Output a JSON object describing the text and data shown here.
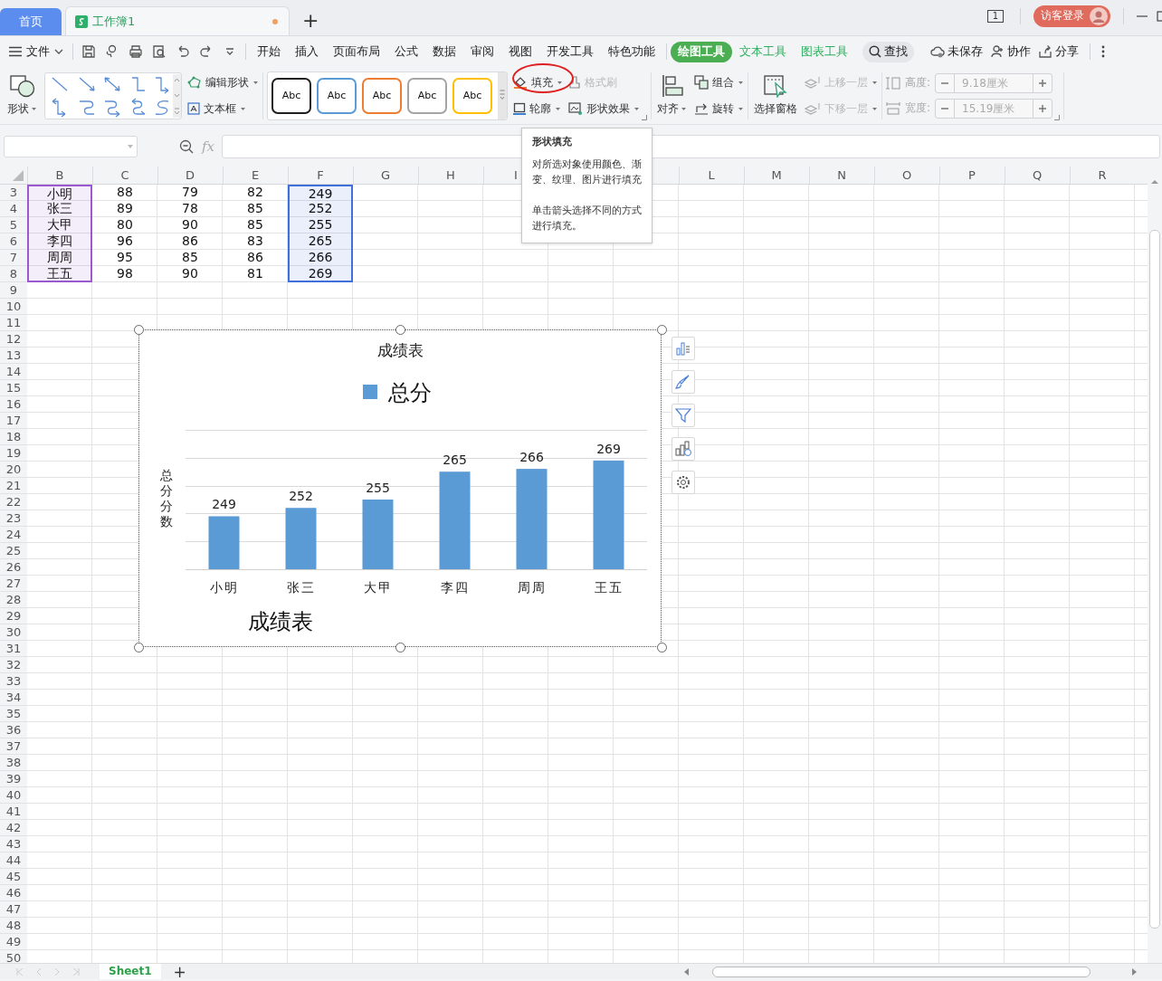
{
  "tabs": [
    {
      "label": "首页",
      "kind": "home",
      "selected": false
    },
    {
      "label": "工作簿1",
      "kind": "doc",
      "selected": true,
      "modified": true
    }
  ],
  "new_tab_button": "+",
  "page_count": "1",
  "login_button": "访客登录",
  "menu_bar": {
    "file_menu": "文件",
    "tabs": [
      {
        "label": "开始",
        "kind": "plain",
        "selected": false
      },
      {
        "label": "插入",
        "kind": "plain",
        "selected": false
      },
      {
        "label": "页面布局",
        "kind": "plain",
        "selected": false
      },
      {
        "label": "公式",
        "kind": "plain",
        "selected": false
      },
      {
        "label": "数据",
        "kind": "plain",
        "selected": false
      },
      {
        "label": "审阅",
        "kind": "plain",
        "selected": false
      },
      {
        "label": "视图",
        "kind": "plain",
        "selected": false
      },
      {
        "label": "开发工具",
        "kind": "plain",
        "selected": false
      },
      {
        "label": "特色功能",
        "kind": "plain",
        "selected": false
      },
      {
        "label": "绘图工具",
        "kind": "context",
        "selected": true
      },
      {
        "label": "文本工具",
        "kind": "context",
        "selected": false
      },
      {
        "label": "图表工具",
        "kind": "context",
        "selected": false
      }
    ],
    "search": "查找",
    "actions": [
      {
        "label": "未保存",
        "kind": "cloud"
      },
      {
        "label": "协作",
        "kind": "person"
      },
      {
        "label": "分享",
        "kind": "share"
      }
    ]
  },
  "ribbon": {
    "shape_button": "形状",
    "edit_shape": "编辑形状",
    "text_box": "文本框",
    "style_presets": [
      {
        "label": "Abc",
        "color": "#1f1f1f"
      },
      {
        "label": "Abc",
        "color": "#5b9bd5"
      },
      {
        "label": "Abc",
        "color": "#ed7d31"
      },
      {
        "label": "Abc",
        "color": "#a5a5a5"
      },
      {
        "label": "Abc",
        "color": "#ffc000"
      }
    ],
    "fill": {
      "label": "填充",
      "circled": true
    },
    "outline": "轮廓",
    "format_painter": {
      "label": "格式刷",
      "disabled": true
    },
    "shape_effects": "形状效果",
    "align": "对齐",
    "group": "组合",
    "rotate": "旋转",
    "selection_pane": "选择窗格",
    "bring_forward": {
      "label": "上移一层",
      "disabled": true
    },
    "send_backward": {
      "label": "下移一层",
      "disabled": true
    },
    "height": {
      "label": "高度:",
      "value": "9.18厘米",
      "disabled": true
    },
    "width": {
      "label": "宽度:",
      "value": "15.19厘米",
      "disabled": true
    }
  },
  "formula_bar": {
    "function_label": "fx"
  },
  "tooltip": {
    "title": "形状填充",
    "paragraphs": [
      "对所选对象使用颜色、渐变、纹理、图片进行填充",
      "单击箭头选择不同的方式进行填充。"
    ]
  },
  "sheet": {
    "columns": [
      {
        "label": "B",
        "color": "#9b59d0"
      },
      {
        "label": "C"
      },
      {
        "label": "D"
      },
      {
        "label": "E"
      },
      {
        "label": "F",
        "color": "#3f6fd8"
      },
      {
        "label": "G"
      },
      {
        "label": "H"
      },
      {
        "label": "I"
      },
      {},
      {},
      {
        "label": "L"
      },
      {
        "label": "M"
      },
      {
        "label": "N"
      },
      {
        "label": "O"
      },
      {
        "label": "P"
      },
      {
        "label": "Q"
      },
      {
        "label": "R"
      }
    ],
    "rows": [
      {
        "number": "3",
        "cells": [
          "小明",
          "88",
          "79",
          "82",
          "249"
        ]
      },
      {
        "number": "4",
        "cells": [
          "张三",
          "89",
          "78",
          "85",
          "252"
        ]
      },
      {
        "number": "5",
        "cells": [
          "大甲",
          "80",
          "90",
          "85",
          "255"
        ]
      },
      {
        "number": "6",
        "cells": [
          "李四",
          "96",
          "86",
          "83",
          "265"
        ]
      },
      {
        "number": "7",
        "cells": [
          "周周",
          "95",
          "85",
          "86",
          "266"
        ]
      },
      {
        "number": "8",
        "cells": [
          "王五",
          "98",
          "90",
          "81",
          "269"
        ]
      },
      {
        "number": "9"
      },
      {
        "number": "10"
      },
      {
        "number": "11"
      },
      {
        "number": "12"
      },
      {
        "number": "13"
      },
      {
        "number": "14"
      },
      {
        "number": "15"
      },
      {
        "number": "16"
      },
      {
        "number": "17"
      },
      {
        "number": "18"
      },
      {
        "number": "19"
      },
      {
        "number": "20"
      },
      {
        "number": "21"
      },
      {
        "number": "22"
      },
      {
        "number": "23"
      },
      {
        "number": "24"
      },
      {
        "number": "25"
      },
      {
        "number": "26"
      },
      {
        "number": "27"
      },
      {
        "number": "28"
      },
      {
        "number": "29"
      },
      {
        "number": "30"
      },
      {
        "number": "31"
      },
      {
        "number": "32"
      },
      {
        "number": "33"
      },
      {
        "number": "34"
      },
      {
        "number": "35"
      },
      {
        "number": "36"
      },
      {
        "number": "37"
      },
      {
        "number": "38"
      },
      {
        "number": "39"
      },
      {
        "number": "40"
      },
      {
        "number": "41"
      },
      {
        "number": "42"
      },
      {
        "number": "43"
      },
      {
        "number": "44"
      },
      {
        "number": "45"
      },
      {
        "number": "46"
      },
      {
        "number": "47"
      },
      {
        "number": "48"
      },
      {
        "number": "49"
      },
      {
        "number": "50"
      }
    ]
  },
  "chart": {
    "chart_data": {
      "type": "bar",
      "title": "成绩表",
      "xlabel": "成绩表",
      "ylabel": "总分分数",
      "categories": [
        "小明",
        "张三",
        "大甲",
        "李四",
        "周周",
        "王五"
      ],
      "series": [
        {
          "name": "总分",
          "color": "#5b9bd5",
          "values": [
            249,
            252,
            255,
            265,
            266,
            269
          ]
        }
      ],
      "ylim": [
        230,
        280
      ],
      "data_labels": true
    }
  },
  "sheet_tabs": [
    {
      "label": "Sheet1",
      "selected": true
    }
  ],
  "add_sheet_button": "+"
}
